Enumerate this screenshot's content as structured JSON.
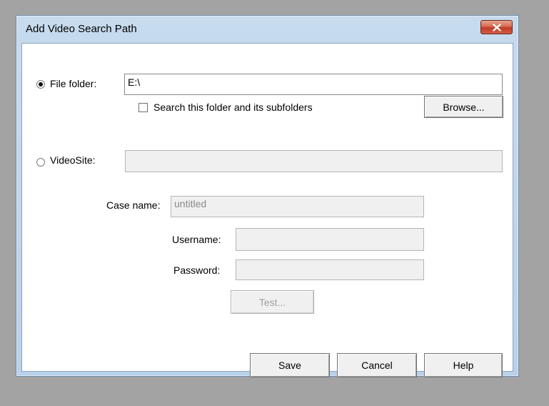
{
  "window": {
    "title": "Add Video Search Path"
  },
  "file_folder": {
    "label": "File folder:",
    "selected": true,
    "path_value": "E:\\",
    "subfolders_label": "Search this folder and its subfolders",
    "subfolders_checked": false,
    "browse_label": "Browse..."
  },
  "videosite": {
    "label": "VideoSite:",
    "selected": false,
    "value": "",
    "case_name_label": "Case name:",
    "case_name_value": "untitled",
    "username_label": "Username:",
    "username_value": "",
    "password_label": "Password:",
    "password_value": "",
    "test_label": "Test..."
  },
  "footer": {
    "save_label": "Save",
    "cancel_label": "Cancel",
    "help_label": "Help"
  },
  "colors": {
    "desktop": "#a3a3a3",
    "frame": "#b9d1ea",
    "close_button": "#c0392b"
  }
}
